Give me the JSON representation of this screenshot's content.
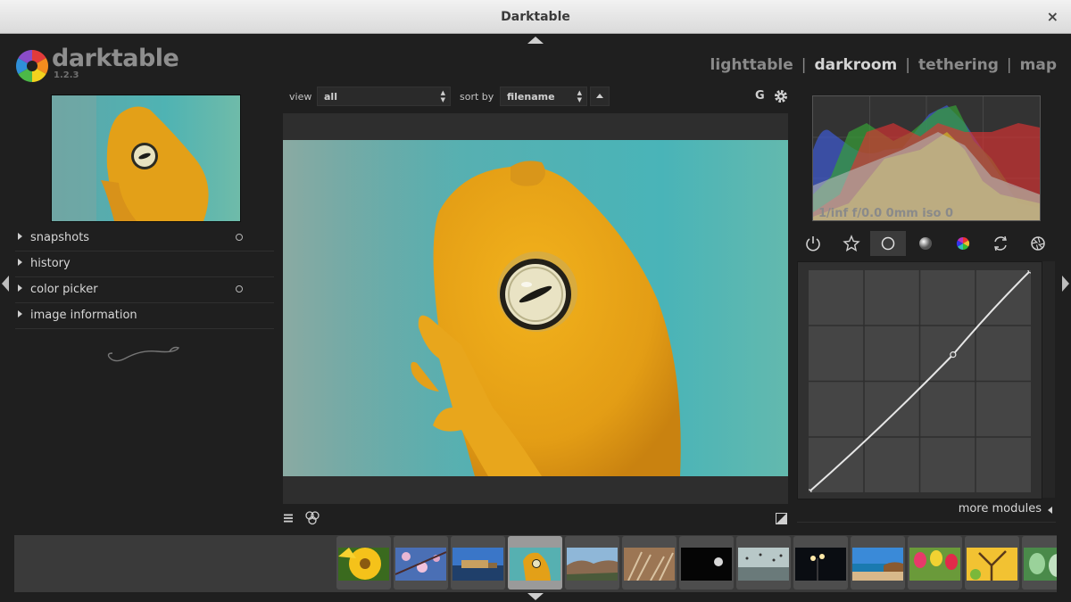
{
  "window": {
    "title": "Darktable",
    "close_glyph": "×"
  },
  "app": {
    "name": "darktable",
    "version": "1.2.3"
  },
  "views": [
    {
      "label": "lighttable",
      "active": false
    },
    {
      "label": "darkroom",
      "active": true
    },
    {
      "label": "tethering",
      "active": false
    },
    {
      "label": "map",
      "active": false
    }
  ],
  "view_separator": "|",
  "left_panel": {
    "modules": [
      {
        "label": "snapshots",
        "has_reset": true
      },
      {
        "label": "history",
        "has_reset": false
      },
      {
        "label": "color picker",
        "has_reset": true
      },
      {
        "label": "image information",
        "has_reset": false
      }
    ]
  },
  "top_toolbar": {
    "view_label": "view",
    "view_value": "all",
    "sort_label": "sort by",
    "sort_value": "filename",
    "grouping_label": "G",
    "updown_glyph": "▲▼",
    "icons": [
      "sort-direction-icon",
      "gear-icon"
    ]
  },
  "bottom_tools": {
    "icons": [
      "presets-menu-icon",
      "styles-icon",
      "overexposed-indicator-icon"
    ]
  },
  "histogram": {
    "exif": "1/inf f/0.0 0mm iso 0"
  },
  "module_groups": {
    "icons": [
      "power-icon",
      "favorite-star-icon",
      "basic-circle-icon",
      "tone-gradient-icon",
      "color-wheel-icon",
      "correct-rotate-icon",
      "effect-aperture-icon"
    ],
    "active_index": 2
  },
  "tone_curve": {
    "nodes": [
      [
        0,
        0
      ],
      [
        0.65,
        0.62
      ],
      [
        1,
        1
      ]
    ]
  },
  "more_modules": {
    "label": "more modules"
  },
  "filmstrip": {
    "thumbnails": [
      {
        "name": "sunflower",
        "current": false
      },
      {
        "name": "blossoms",
        "current": false
      },
      {
        "name": "coast-castle",
        "current": false
      },
      {
        "name": "frog",
        "current": true
      },
      {
        "name": "canyon",
        "current": false
      },
      {
        "name": "grass",
        "current": false
      },
      {
        "name": "moon",
        "current": false
      },
      {
        "name": "birds",
        "current": false
      },
      {
        "name": "street-lamp",
        "current": false
      },
      {
        "name": "beach",
        "current": false
      },
      {
        "name": "tulips",
        "current": false
      },
      {
        "name": "autumn-tree",
        "current": false
      },
      {
        "name": "leaves",
        "current": false
      }
    ]
  },
  "colors": {
    "accent_frog": "#e8a417",
    "background": "#1f1f1f"
  }
}
